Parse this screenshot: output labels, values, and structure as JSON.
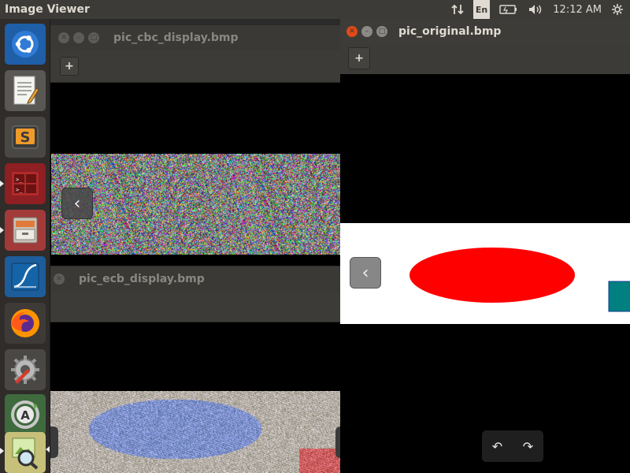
{
  "top_panel": {
    "app_title": "Image Viewer",
    "network_icon": "transfer-arrows-icon",
    "keyboard_layout": "En",
    "battery_icon": "battery-icon",
    "volume_icon": "volume-icon",
    "clock": "12:12 AM",
    "system_icon": "gear-icon"
  },
  "launcher": {
    "items": [
      {
        "name": "ubuntu-dash",
        "icon": "ubuntu-logo-icon"
      },
      {
        "name": "text-editor",
        "icon": "text-editor-icon"
      },
      {
        "name": "sublime-text",
        "icon": "sublime-text-icon"
      },
      {
        "name": "terminal",
        "icon": "terminal-icon"
      },
      {
        "name": "file-cabinet",
        "icon": "file-cabinet-icon"
      },
      {
        "name": "wireshark",
        "icon": "wireshark-fin-icon"
      },
      {
        "name": "firefox",
        "icon": "firefox-icon"
      },
      {
        "name": "system-settings",
        "icon": "settings-wrench-icon"
      },
      {
        "name": "software-updater",
        "icon": "software-updater-icon"
      },
      {
        "name": "image-viewer",
        "icon": "image-viewer-icon"
      }
    ]
  },
  "windows": {
    "cbc": {
      "title": "pic_cbc_display.bmp"
    },
    "ecb": {
      "title": "pic_ecb_display.bmp"
    },
    "original": {
      "title": "pic_original.bmp"
    }
  },
  "colors": {
    "ellipse": "#ff0000",
    "teal_square": "#008080",
    "panel": "#3c3b37",
    "close_button": "#df4a16"
  }
}
